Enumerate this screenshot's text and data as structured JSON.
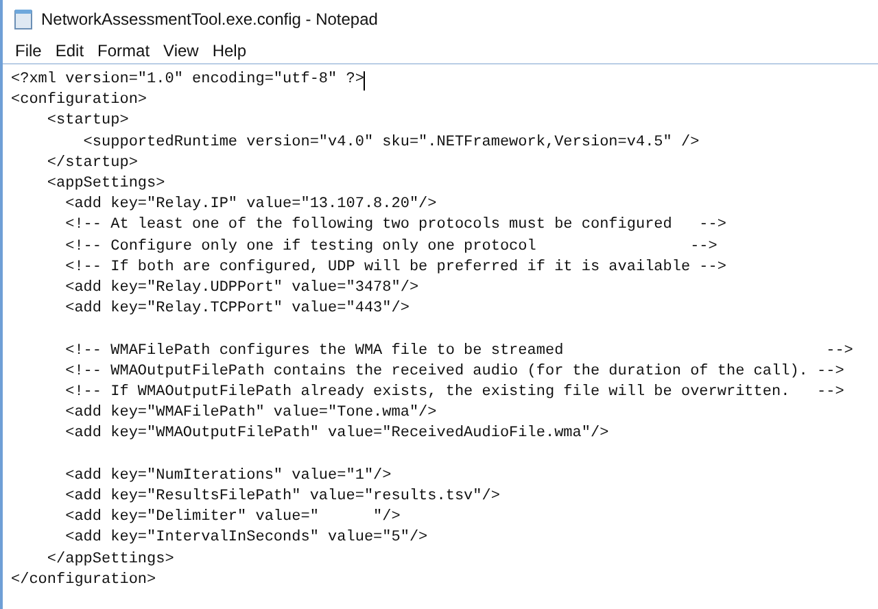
{
  "window": {
    "title": "NetworkAssessmentTool.exe.config - Notepad"
  },
  "menu": [
    "File",
    "Edit",
    "Format",
    "View",
    "Help"
  ],
  "editor": {
    "blocks": [
      [
        "<?xml version=\"1.0\" encoding=\"utf-8\" ?>",
        "<configuration>",
        "    <startup>",
        "        <supportedRuntime version=\"v4.0\" sku=\".NETFramework,Version=v4.5\" />",
        "    </startup>",
        "    <appSettings>",
        "      <add key=\"Relay.IP\" value=\"13.107.8.20\"/>",
        "      <!-- At least one of the following two protocols must be configured   -->",
        "      <!-- Configure only one if testing only one protocol                 -->",
        "      <!-- If both are configured, UDP will be preferred if it is available -->",
        "      <add key=\"Relay.UDPPort\" value=\"3478\"/>",
        "      <add key=\"Relay.TCPPort\" value=\"443\"/>"
      ],
      [
        "      <!-- WMAFilePath configures the WMA file to be streamed                             -->",
        "      <!-- WMAOutputFilePath contains the received audio (for the duration of the call). -->",
        "      <!-- If WMAOutputFilePath already exists, the existing file will be overwritten.   -->",
        "      <add key=\"WMAFilePath\" value=\"Tone.wma\"/>",
        "      <add key=\"WMAOutputFilePath\" value=\"ReceivedAudioFile.wma\"/>"
      ],
      [
        "      <add key=\"NumIterations\" value=\"1\"/>",
        "      <add key=\"ResultsFilePath\" value=\"results.tsv\"/>",
        "      <add key=\"Delimiter\" value=\"      \"/>",
        "      <add key=\"IntervalInSeconds\" value=\"5\"/>",
        "    </appSettings>",
        "</configuration>"
      ]
    ]
  }
}
